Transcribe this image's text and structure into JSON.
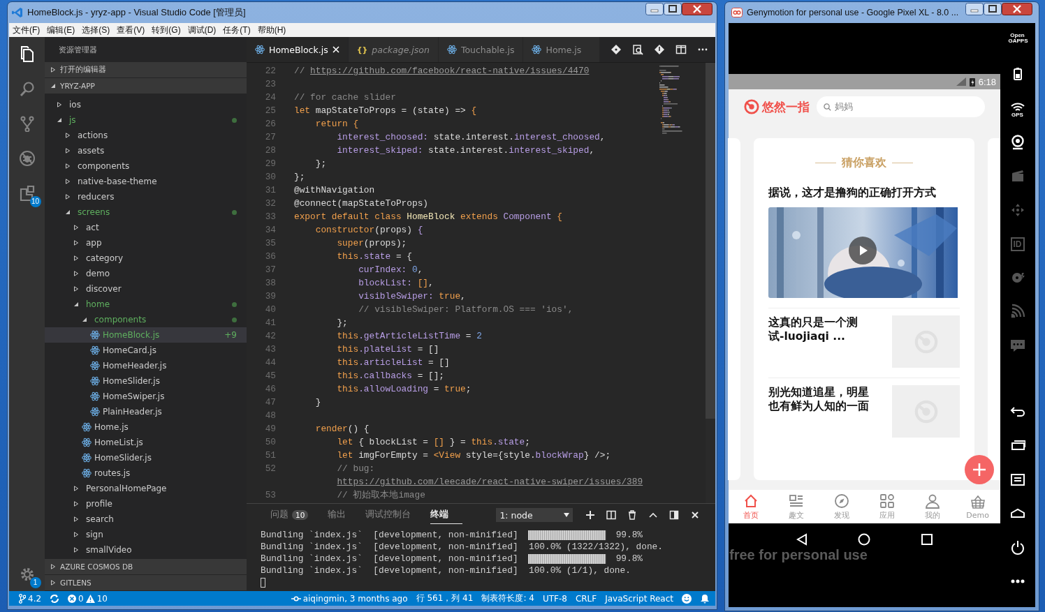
{
  "vscode": {
    "title": "HomeBlock.js - yryz-app - Visual Studio Code [管理员]",
    "menu": [
      "文件(F)",
      "编辑(E)",
      "选择(S)",
      "查看(V)",
      "转到(G)",
      "调试(D)",
      "任务(T)",
      "帮助(H)"
    ],
    "activity_bar": {
      "items": [
        {
          "kind": "files",
          "selected": true
        },
        {
          "kind": "search",
          "selected": false
        },
        {
          "kind": "scm",
          "selected": false
        },
        {
          "kind": "debug",
          "selected": false
        },
        {
          "kind": "extensions",
          "selected": false,
          "badge": "10"
        }
      ],
      "settings_badge": "1"
    },
    "sidebar": {
      "title": "资源管理器",
      "sections": [
        {
          "label": "打开的编辑器",
          "expanded": false
        },
        {
          "label": "YRYZ-APP",
          "expanded": true,
          "tree": [
            {
              "label": "ios",
              "kind": "folder",
              "expanded": false,
              "selected": false,
              "modified": false
            },
            {
              "label": "js",
              "kind": "folder",
              "expanded": true,
              "selected": false,
              "modified": true,
              "children": [
                {
                  "label": "actions",
                  "kind": "folder",
                  "expanded": false,
                  "selected": false,
                  "modified": false
                },
                {
                  "label": "assets",
                  "kind": "folder",
                  "expanded": false,
                  "selected": false,
                  "modified": false
                },
                {
                  "label": "components",
                  "kind": "folder",
                  "expanded": false,
                  "selected": false,
                  "modified": false
                },
                {
                  "label": "native-base-theme",
                  "kind": "folder",
                  "expanded": false,
                  "selected": false,
                  "modified": false
                },
                {
                  "label": "reducers",
                  "kind": "folder",
                  "expanded": false,
                  "selected": false,
                  "modified": false
                },
                {
                  "label": "screens",
                  "kind": "folder",
                  "expanded": true,
                  "selected": false,
                  "modified": true,
                  "children": [
                    {
                      "label": "act",
                      "kind": "folder",
                      "expanded": false,
                      "selected": false,
                      "modified": false
                    },
                    {
                      "label": "app",
                      "kind": "folder",
                      "expanded": false,
                      "selected": false,
                      "modified": false
                    },
                    {
                      "label": "category",
                      "kind": "folder",
                      "expanded": false,
                      "selected": false,
                      "modified": false
                    },
                    {
                      "label": "demo",
                      "kind": "folder",
                      "expanded": false,
                      "selected": false,
                      "modified": false
                    },
                    {
                      "label": "discover",
                      "kind": "folder",
                      "expanded": false,
                      "selected": false,
                      "modified": false
                    },
                    {
                      "label": "home",
                      "kind": "folder",
                      "expanded": true,
                      "selected": false,
                      "modified": true,
                      "children": [
                        {
                          "label": "components",
                          "kind": "folder",
                          "expanded": true,
                          "selected": false,
                          "modified": true,
                          "children": [
                            {
                              "label": "HomeBlock.js",
                              "kind": "file",
                              "selected": true,
                              "modified": true,
                              "badge": "+9"
                            },
                            {
                              "label": "HomeCard.js",
                              "kind": "file",
                              "selected": false,
                              "modified": false
                            },
                            {
                              "label": "HomeHeader.js",
                              "kind": "file",
                              "selected": false,
                              "modified": false
                            },
                            {
                              "label": "HomeSlider.js",
                              "kind": "file",
                              "selected": false,
                              "modified": false
                            },
                            {
                              "label": "HomeSwiper.js",
                              "kind": "file",
                              "selected": false,
                              "modified": false
                            },
                            {
                              "label": "PlainHeader.js",
                              "kind": "file",
                              "selected": false,
                              "modified": false
                            }
                          ]
                        },
                        {
                          "label": "Home.js",
                          "kind": "file",
                          "selected": false,
                          "modified": false
                        },
                        {
                          "label": "HomeList.js",
                          "kind": "file",
                          "selected": false,
                          "modified": false
                        },
                        {
                          "label": "HomeSlider.js",
                          "kind": "file",
                          "selected": false,
                          "modified": false
                        },
                        {
                          "label": "routes.js",
                          "kind": "file",
                          "selected": false,
                          "modified": false
                        }
                      ]
                    },
                    {
                      "label": "PersonalHomePage",
                      "kind": "folder",
                      "expanded": false,
                      "selected": false,
                      "modified": false
                    },
                    {
                      "label": "profile",
                      "kind": "folder",
                      "expanded": false,
                      "selected": false,
                      "modified": false
                    },
                    {
                      "label": "search",
                      "kind": "folder",
                      "expanded": false,
                      "selected": false,
                      "modified": false
                    },
                    {
                      "label": "sign",
                      "kind": "folder",
                      "expanded": false,
                      "selected": false,
                      "modified": false
                    },
                    {
                      "label": "smallVideo",
                      "kind": "folder",
                      "expanded": false,
                      "selected": false,
                      "modified": false
                    }
                  ]
                }
              ]
            }
          ]
        },
        {
          "label": "AZURE COSMOS DB",
          "expanded": false
        },
        {
          "label": "GITLENS",
          "expanded": false
        }
      ]
    },
    "tabs": [
      {
        "label": "HomeBlock.js",
        "kind": "react",
        "selected": true,
        "preview": false
      },
      {
        "label": "package.json",
        "kind": "json",
        "glyph": "{}",
        "selected": false,
        "preview": true
      },
      {
        "label": "Touchable.js",
        "kind": "react",
        "selected": false,
        "preview": false
      },
      {
        "label": "Home.js",
        "kind": "react",
        "selected": false,
        "preview": false
      }
    ],
    "code": [
      {
        "number": "22",
        "tokens": [
          {
            "kind": "comment",
            "text": "// "
          },
          {
            "kind": "link",
            "text": "https://github.com/facebook/react-native/issues/4470"
          }
        ]
      },
      {
        "number": "23"
      },
      {
        "number": "24",
        "tokens": [
          {
            "kind": "comment",
            "text": "// for cache slider"
          }
        ]
      },
      {
        "number": "25",
        "tokens": [
          {
            "kind": "keyword",
            "text": "let "
          },
          {
            "kind": "plain",
            "text": "mapStateToProps = (state) => "
          },
          {
            "kind": "keyword",
            "text": "{"
          }
        ]
      },
      {
        "number": "26",
        "tokens": [
          {
            "kind": "keyword",
            "text": "    return {"
          }
        ]
      },
      {
        "number": "27",
        "tokens": [
          {
            "kind": "property",
            "text": "        interest_choosed: "
          },
          {
            "kind": "plain",
            "text": "state.interest."
          },
          {
            "kind": "property",
            "text": "interest_choosed"
          },
          {
            "kind": "plain",
            "text": ","
          }
        ]
      },
      {
        "number": "28",
        "tokens": [
          {
            "kind": "property",
            "text": "        interest_skiped: "
          },
          {
            "kind": "plain",
            "text": "state.interest."
          },
          {
            "kind": "property",
            "text": "interest_skiped"
          },
          {
            "kind": "plain",
            "text": ","
          }
        ]
      },
      {
        "number": "29",
        "tokens": [
          {
            "kind": "plain",
            "text": "    };"
          }
        ]
      },
      {
        "number": "30",
        "tokens": [
          {
            "kind": "plain",
            "text": "};"
          }
        ]
      },
      {
        "number": "31",
        "tokens": [
          {
            "kind": "plain",
            "text": "@withNavigation"
          }
        ]
      },
      {
        "number": "32",
        "tokens": [
          {
            "kind": "plain",
            "text": "@connect(mapStateToProps)"
          }
        ]
      },
      {
        "number": "33",
        "tokens": [
          {
            "kind": "keyword",
            "text": "export default class "
          },
          {
            "kind": "type",
            "text": "HomeBlock "
          },
          {
            "kind": "keyword",
            "text": "extends "
          },
          {
            "kind": "property",
            "text": "Component "
          },
          {
            "kind": "keyword",
            "text": "{"
          }
        ]
      },
      {
        "number": "34",
        "tokens": [
          {
            "kind": "keyword",
            "text": "    constructor"
          },
          {
            "kind": "plain",
            "text": "(props) "
          },
          {
            "kind": "property",
            "text": "{"
          }
        ]
      },
      {
        "number": "35",
        "tokens": [
          {
            "kind": "keyword",
            "text": "        super"
          },
          {
            "kind": "plain",
            "text": "(props);"
          }
        ]
      },
      {
        "number": "36",
        "tokens": [
          {
            "kind": "keyword",
            "text": "        this"
          },
          {
            "kind": "property",
            "text": ".state"
          },
          {
            "kind": "plain",
            "text": " = {"
          }
        ]
      },
      {
        "number": "37",
        "tokens": [
          {
            "kind": "property",
            "text": "            curIndex: "
          },
          {
            "kind": "number",
            "text": "0"
          },
          {
            "kind": "plain",
            "text": ","
          }
        ]
      },
      {
        "number": "38",
        "tokens": [
          {
            "kind": "property",
            "text": "            blockList: "
          },
          {
            "kind": "keyword",
            "text": "[]"
          },
          {
            "kind": "plain",
            "text": ","
          }
        ]
      },
      {
        "number": "39",
        "tokens": [
          {
            "kind": "property",
            "text": "            visibleSwiper: "
          },
          {
            "kind": "keyword",
            "text": "true"
          },
          {
            "kind": "plain",
            "text": ","
          }
        ]
      },
      {
        "number": "40",
        "tokens": [
          {
            "kind": "comment",
            "text": "            // visibleSwiper: Platform.OS === 'ios',"
          }
        ]
      },
      {
        "number": "41",
        "tokens": [
          {
            "kind": "plain",
            "text": "        };"
          }
        ]
      },
      {
        "number": "42",
        "tokens": [
          {
            "kind": "keyword",
            "text": "        this"
          },
          {
            "kind": "property",
            "text": ".getArticleListTime"
          },
          {
            "kind": "plain",
            "text": " = "
          },
          {
            "kind": "number",
            "text": "2"
          }
        ]
      },
      {
        "number": "43",
        "tokens": [
          {
            "kind": "keyword",
            "text": "        this"
          },
          {
            "kind": "property",
            "text": ".plateList"
          },
          {
            "kind": "plain",
            "text": " = []"
          }
        ]
      },
      {
        "number": "44",
        "tokens": [
          {
            "kind": "keyword",
            "text": "        this"
          },
          {
            "kind": "property",
            "text": ".articleList"
          },
          {
            "kind": "plain",
            "text": " = []"
          }
        ]
      },
      {
        "number": "45",
        "tokens": [
          {
            "kind": "keyword",
            "text": "        this"
          },
          {
            "kind": "property",
            "text": ".callbacks"
          },
          {
            "kind": "plain",
            "text": " = [];"
          }
        ]
      },
      {
        "number": "46",
        "tokens": [
          {
            "kind": "keyword",
            "text": "        this"
          },
          {
            "kind": "property",
            "text": ".allowLoading"
          },
          {
            "kind": "plain",
            "text": " = "
          },
          {
            "kind": "keyword",
            "text": "true"
          },
          {
            "kind": "plain",
            "text": ";"
          }
        ]
      },
      {
        "number": "47",
        "tokens": [
          {
            "kind": "plain",
            "text": "    }"
          }
        ]
      },
      {
        "number": "48"
      },
      {
        "number": "49",
        "tokens": [
          {
            "kind": "keyword",
            "text": "    render"
          },
          {
            "kind": "plain",
            "text": "() {"
          }
        ]
      },
      {
        "number": "50",
        "tokens": [
          {
            "kind": "keyword",
            "text": "        let "
          },
          {
            "kind": "plain",
            "text": "{ blockList = "
          },
          {
            "kind": "keyword",
            "text": "[]"
          },
          {
            "kind": "plain",
            "text": " } = "
          },
          {
            "kind": "keyword",
            "text": "this"
          },
          {
            "kind": "property",
            "text": ".state"
          },
          {
            "kind": "plain",
            "text": ";"
          }
        ]
      },
      {
        "number": "51",
        "tokens": [
          {
            "kind": "keyword",
            "text": "        let "
          },
          {
            "kind": "plain",
            "text": "imgForEmpty = "
          },
          {
            "kind": "keyword",
            "text": "<View "
          },
          {
            "kind": "plain",
            "text": "style={style."
          },
          {
            "kind": "property",
            "text": "blockWrap"
          },
          {
            "kind": "plain",
            "text": "} />;"
          }
        ]
      },
      {
        "number": "52",
        "tokens": [
          {
            "kind": "comment",
            "text": "        // bug:"
          }
        ]
      },
      {
        "tokens": [
          {
            "kind": "link",
            "text": "        https://github.com/leecade/react-native-swiper/issues/389"
          }
        ]
      },
      {
        "number": "53",
        "tokens": [
          {
            "kind": "comment",
            "text": "        // 初始取本地image"
          }
        ]
      }
    ],
    "panel": {
      "tabs": [
        {
          "label": "问题",
          "badge": "10",
          "selected": false
        },
        {
          "label": "输出",
          "selected": false
        },
        {
          "label": "调试控制台",
          "selected": false
        },
        {
          "label": "终端",
          "selected": true
        }
      ],
      "terminal_select": "1: node",
      "lines": [
        {
          "kind": "progress",
          "text": "Bundling `index.js`  [development, non-minified]",
          "level": 0.998,
          "reading": "99.8%"
        },
        {
          "kind": "done",
          "text": "Bundling `index.js`  [development, non-minified]",
          "result": "100.0% (1322/1322), done."
        },
        {
          "kind": "progress",
          "text": "Bundling `index.js`  [development, non-minified]",
          "level": 0.998,
          "reading": "99.8%"
        },
        {
          "kind": "done",
          "text": "Bundling `index.js`  [development, non-minified]",
          "result": "100.0% (1/1), done."
        }
      ]
    },
    "status": {
      "branch": "4.2",
      "errors": "0",
      "warnings": "10",
      "blame": "aiqingmin, 3 months ago",
      "position": "行 561，列 41",
      "indent": "制表符长度: 4",
      "encoding": "UTF-8",
      "eol": "CRLF",
      "language": "JavaScript React"
    }
  },
  "genymotion": {
    "title": "Genymotion for personal use - Google Pixel XL - 8.0 ...",
    "time": "6:18",
    "app": {
      "logo": "悠然一指",
      "search_placeholder": "妈妈",
      "section_title": "猜你喜欢",
      "articles": [
        {
          "kind": "video",
          "title": "据说，这才是撸狗的正确打开方式"
        },
        {
          "kind": "thumb",
          "title": "这真的只是一个测试-luojiaqi ..."
        },
        {
          "kind": "thumb",
          "title": "别光知道追星，明星也有鲜为人知的一面"
        }
      ],
      "tabs": [
        {
          "label": "首页",
          "kind": "home",
          "selected": true
        },
        {
          "label": "趣文",
          "kind": "article",
          "selected": false
        },
        {
          "label": "发现",
          "kind": "compass",
          "selected": false
        },
        {
          "label": "应用",
          "kind": "apps",
          "selected": false
        },
        {
          "label": "我的",
          "kind": "person",
          "selected": false
        },
        {
          "label": "Demo",
          "kind": "basket",
          "selected": false
        }
      ]
    },
    "watermark": "free for personal use",
    "tools": [
      {
        "kind": "gapps",
        "label": "Open GAPPS",
        "disabled": false
      },
      {
        "kind": "battery",
        "disabled": false
      },
      {
        "kind": "gps",
        "label": "GPS",
        "disabled": false
      },
      {
        "kind": "webcam",
        "disabled": false
      },
      {
        "kind": "film",
        "disabled": true
      },
      {
        "kind": "dpad",
        "disabled": true
      },
      {
        "kind": "id",
        "label": "ID",
        "disabled": true
      },
      {
        "kind": "disk",
        "disabled": true
      },
      {
        "kind": "cast",
        "disabled": true
      },
      {
        "kind": "sms",
        "disabled": true
      }
    ],
    "keys": [
      {
        "kind": "back"
      },
      {
        "kind": "recents"
      },
      {
        "kind": "menu"
      },
      {
        "kind": "home"
      },
      {
        "kind": "power"
      },
      {
        "kind": "more"
      }
    ]
  }
}
